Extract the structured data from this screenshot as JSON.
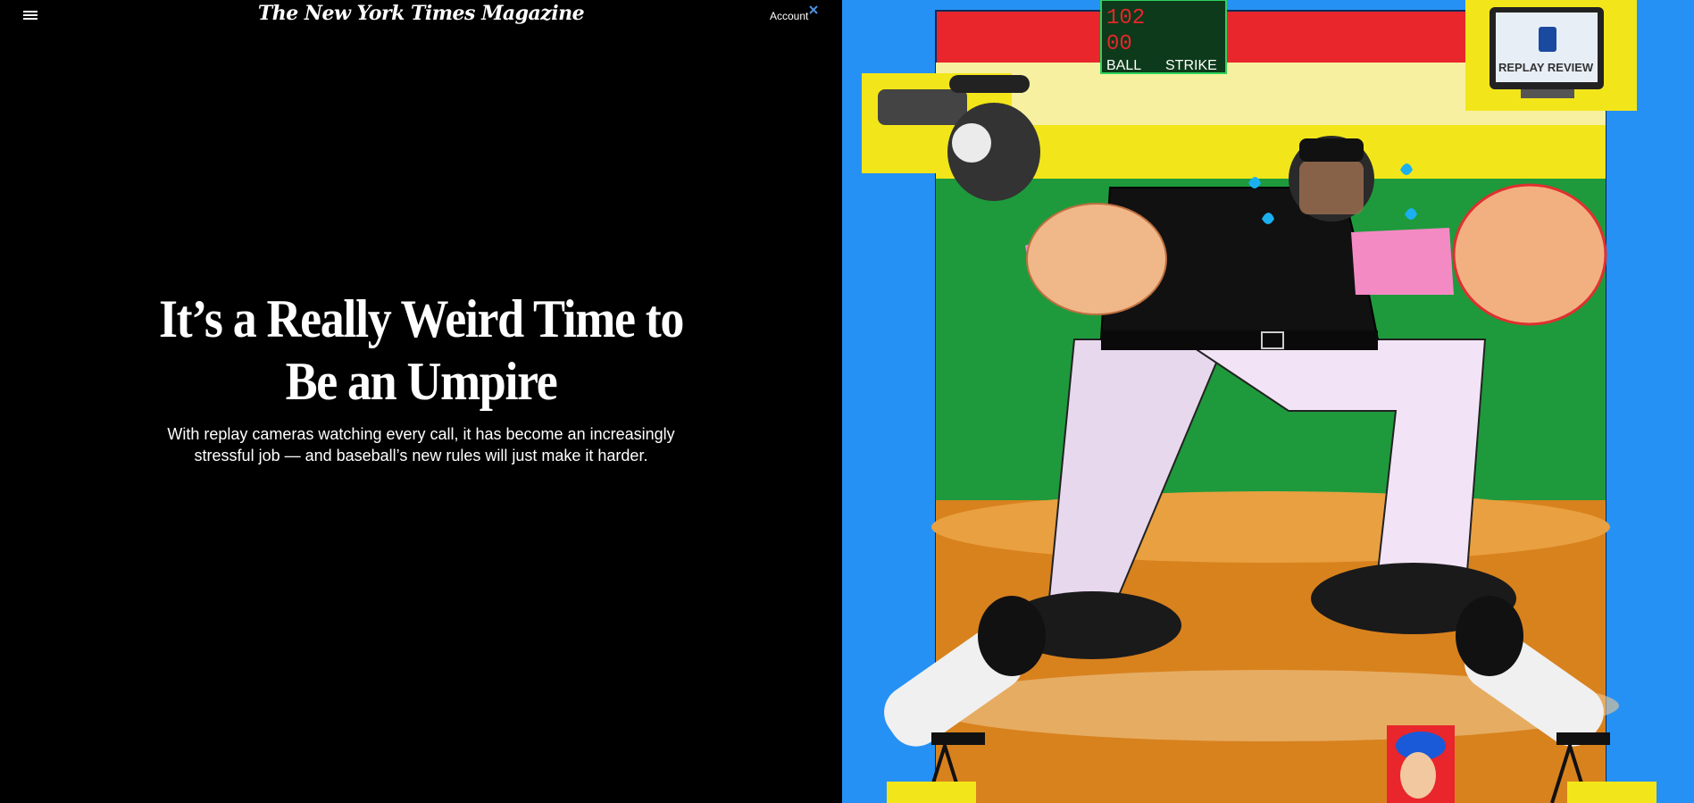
{
  "header": {
    "masthead": "The New York Times Magazine",
    "account_label": "Account"
  },
  "article": {
    "headline": "It’s a Really Weird Time to Be an Umpire",
    "dek": "With replay cameras watching every call, it has become an increasingly stressful job — and baseball’s new rules will just make it harder."
  },
  "illustration": {
    "scoreboard": {
      "ball_label": "BALL",
      "strike_label": "STRIKE",
      "top_digits": "102",
      "bottom_digits": "00"
    },
    "monitor_label": "REPLAY REVIEW",
    "colors": {
      "sky_blue": "#1e8cf0",
      "field_green": "#1e9a3c",
      "dirt_orange": "#d8821e",
      "banner_red": "#e8262c",
      "banner_yellow": "#f2e61a"
    }
  }
}
